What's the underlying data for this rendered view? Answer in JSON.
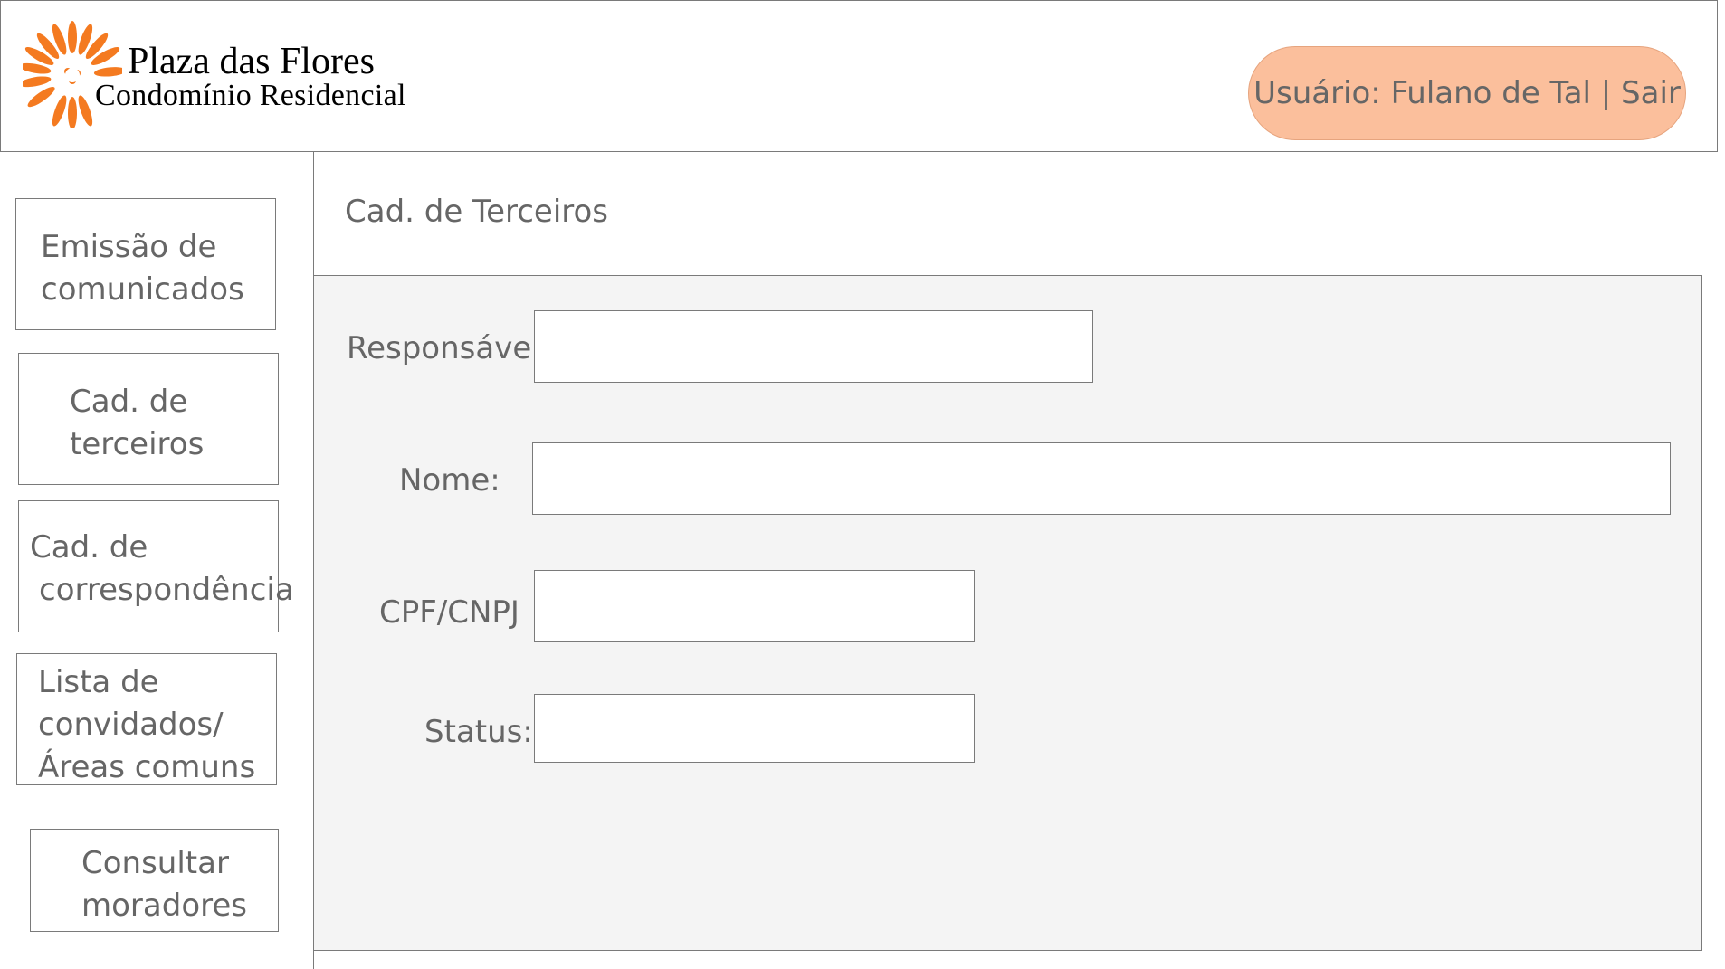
{
  "brand": {
    "title": "Plaza das Flores",
    "subtitle": "Condomínio Residencial",
    "logo_icon": "flower-logo-icon",
    "accent_color": "#f47a20"
  },
  "header": {
    "user_label": "Usuário: Fulano de Tal | Sair",
    "user_pill_color": "#fbbf9c"
  },
  "sidebar": {
    "items": [
      {
        "lines": [
          "Emissão de",
          "comunicados"
        ]
      },
      {
        "lines": [
          "Cad. de",
          "terceiros"
        ]
      },
      {
        "lines": [
          "Cad. de",
          "correspondência"
        ]
      },
      {
        "lines": [
          "Lista de",
          "convidados/",
          "Áreas comuns"
        ]
      },
      {
        "lines": [
          "Consultar",
          "moradores"
        ]
      }
    ]
  },
  "main": {
    "title": "Cad. de Terceiros",
    "panel_color": "#f4f4f4",
    "fields": [
      {
        "label": "Responsável:",
        "value": ""
      },
      {
        "label": "Nome:",
        "value": ""
      },
      {
        "label": "CPF/CNPJ",
        "value": ""
      },
      {
        "label": "Status:",
        "value": ""
      }
    ]
  }
}
